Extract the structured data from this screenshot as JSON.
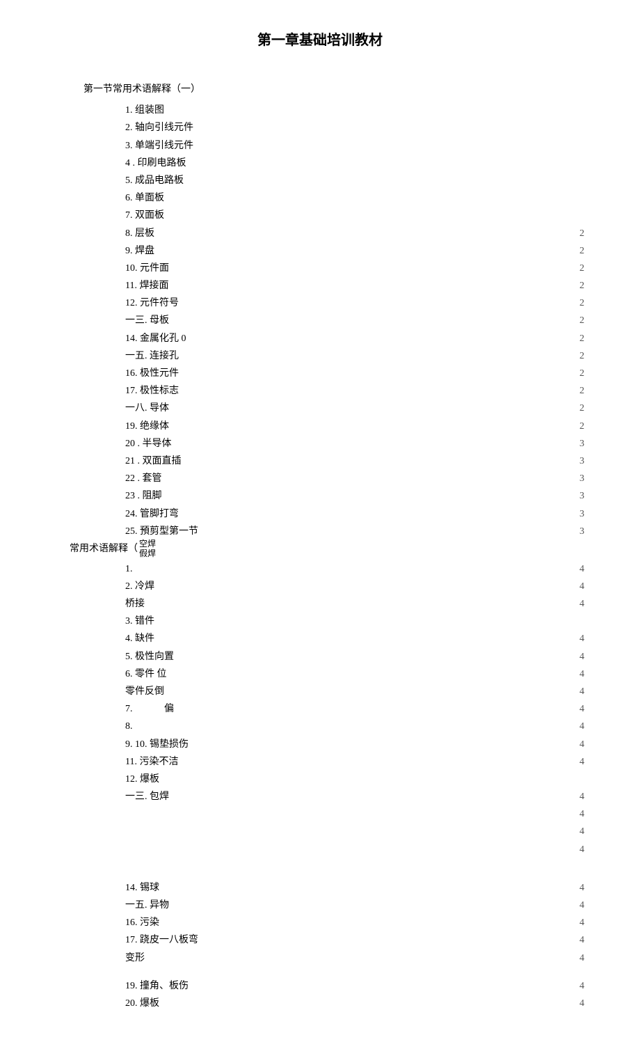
{
  "title": "第一章基础培训教材",
  "section1": {
    "title": "第一节常用术语解释（一）",
    "items": [
      {
        "text": "1. 组装图",
        "page": ""
      },
      {
        "text": "2. 轴向引线元件",
        "page": ""
      },
      {
        "text": "3. 单端引线元件",
        "page": ""
      },
      {
        "text": "4 . 印刷电路板",
        "page": ""
      },
      {
        "text": "5. 成品电路板",
        "page": ""
      },
      {
        "text": "6. 单面板",
        "page": ""
      },
      {
        "text": "7. 双面板",
        "page": ""
      },
      {
        "text": "8. 层板",
        "page": "2"
      },
      {
        "text": "9. 焊盘",
        "page": "2"
      },
      {
        "text": "10. 元件面",
        "page": "2"
      },
      {
        "text": "11. 焊接面",
        "page": "2"
      },
      {
        "text": "12. 元件符号",
        "page": "2"
      },
      {
        "text": "一三. 母板",
        "page": "2"
      },
      {
        "text": "14. 金属化孔 0",
        "page": "2"
      },
      {
        "text": "一五. 连接孔",
        "page": "2"
      },
      {
        "text": "16. 极性元件",
        "page": "2"
      },
      {
        "text": "17. 极性标志",
        "page": "2"
      },
      {
        "text": "一八. 导体",
        "page": "2"
      },
      {
        "text": "19. 绝缘体",
        "page": "2"
      },
      {
        "text": "20 . 半导体",
        "page": "3"
      },
      {
        "text": "21 . 双面直插",
        "page": "3"
      },
      {
        "text": "22 . 套管",
        "page": "3"
      },
      {
        "text": "23 . 阻脚",
        "page": "3"
      },
      {
        "text": "24. 管脚打弯",
        "page": "3"
      }
    ]
  },
  "section2": {
    "last1": "25. 預剪型第一节",
    "stacked1a": "空焊",
    "stacked1b": "假焊",
    "title": "常用术语解释（",
    "page25": "3",
    "items": [
      {
        "num": "1.",
        "text": "",
        "page": "4"
      },
      {
        "num": "2.",
        "text": "冷焊",
        "page": "4"
      },
      {
        "num": "",
        "text": "桥接",
        "page": "4"
      },
      {
        "num": "3.",
        "text": "错件",
        "page": ""
      },
      {
        "num": "4.",
        "text": "缺件",
        "page": "4"
      },
      {
        "num": "5.",
        "text": "极性向置",
        "page": "4"
      },
      {
        "num": "6.",
        "text": "零件 位",
        "page": "4"
      },
      {
        "num": "",
        "text": "零件反倒",
        "page": "4"
      },
      {
        "num": "7.",
        "text": "　　　偏",
        "page": "4"
      },
      {
        "num": "8.",
        "text": "",
        "page": "4"
      },
      {
        "num": "9.",
        "text": "10. 锡垫损伤",
        "page": "4"
      },
      {
        "num": "",
        "text": "11. 污染不洁",
        "page": "4"
      },
      {
        "num": "",
        "text": "12. 爆板",
        "page": ""
      },
      {
        "num": "",
        "text": "一三. 包焊",
        "page": "4"
      }
    ],
    "trail_pages": [
      "4",
      "4",
      "4"
    ],
    "items2": [
      {
        "text": "14. 锡球",
        "page": "4"
      },
      {
        "text": "一五. 异物",
        "page": "4"
      },
      {
        "text": "16. 污染",
        "page": "4"
      },
      {
        "text": "17. 跷皮一八板弯",
        "page": "4"
      },
      {
        "text": "变形",
        "page": "4"
      }
    ],
    "items3": [
      {
        "text": "19. 撞角、板伤",
        "page": "4"
      },
      {
        "text": "20. 爆板",
        "page": "4"
      }
    ]
  }
}
